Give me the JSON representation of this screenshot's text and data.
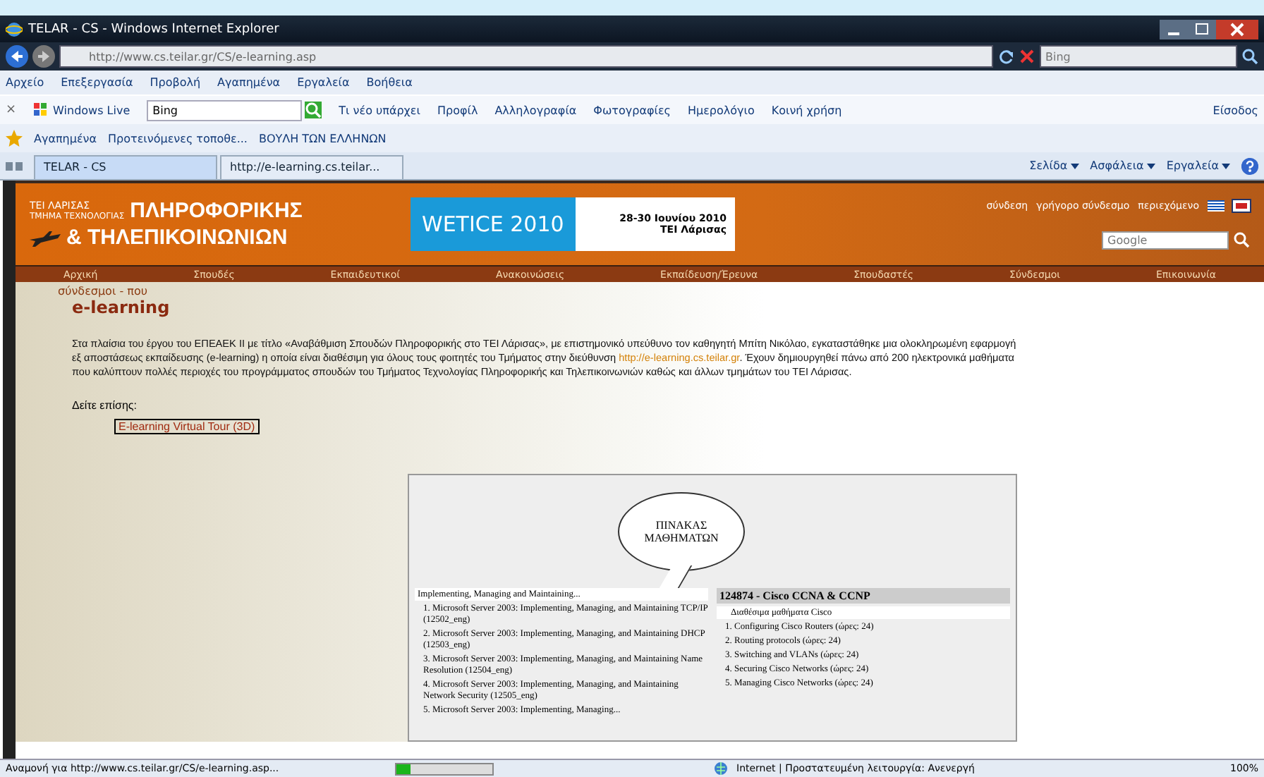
{
  "window": {
    "title": "TELAR - CS - Windows Internet Explorer"
  },
  "address_bar": {
    "value": "http://www.cs.teilar.gr/CS/e-learning.asp"
  },
  "search": {
    "placeholder": "Bing"
  },
  "menu": [
    "Αρχείο",
    "Επεξεργασία",
    "Προβολή",
    "Αγαπημένα",
    "Εργαλεία",
    "Βοήθεια"
  ],
  "links_bar": {
    "close": "×",
    "brand": "Windows Live",
    "search_value": "Bing",
    "links": [
      "Τι νέο υπάρχει",
      "Προφίλ",
      "Αλληλογραφία",
      "Φωτογραφίες",
      "Ημερολόγιο",
      "Κοινή χρήση"
    ],
    "signin": "Είσοδος"
  },
  "favorites_bar": {
    "label": "Αγαπημένα",
    "items": [
      "Προτεινόμενες τοποθε...",
      "ΒΟΥΛΗ ΤΩΝ ΕΛΛΗΝΩΝ"
    ]
  },
  "tabs": [
    {
      "label": "TELAR - CS",
      "selected": true
    },
    {
      "label": "http://e-learning.cs.teilar...",
      "selected": false
    }
  ],
  "commands": [
    "Σελίδα",
    "Ασφάλεια",
    "Εργαλεία"
  ],
  "site_header": {
    "org": "ΤΕΙ ΛΑΡΙΣΑΣ",
    "dept": "ΤΜΗΜΑ ΤΕΧΝΟΛΟΓΙΑΣ",
    "title_1": "ΠΛΗΡΟΦΟΡΙΚΗΣ",
    "title_2": "& ΤΗΛΕΠΙΚΟΙΝΩΝΙΩΝ",
    "banner": {
      "name": "WETICE 2010",
      "dates": "28-30 Ιουνίου 2010",
      "place": "ΤΕΙ Λάρισας"
    },
    "top_links": [
      "σύνδεση",
      "γρήγορο σύνδεσμο",
      "περιεχόμενο"
    ],
    "search_placeholder": "Google"
  },
  "nav": [
    "Αρχική",
    "Σπουδές",
    "Εκπαιδευτικοί",
    "Ανακοινώσεις",
    "Εκπαίδευση/Έρευνα",
    "Σπουδαστές",
    "Σύνδεσμοι",
    "Επικοινωνία"
  ],
  "breadcrumb": "σύνδεσμοι - που",
  "heading": "e-learning",
  "paragraph": "Στα πλαίσια του έργου του ΕΠΕΑΕΚ ΙΙ με τίτλο «Αναβάθμιση Σπουδών Πληροφορικής στο ΤΕΙ Λάρισας», με επιστημονικό υπεύθυνο τον καθηγητή Μπίτη Νικόλαο, εγκαταστάθηκε μια ολοκληρωμένη εφαρμογή εξ αποστάσεως εκπαίδευσης (e-learning) η οποία είναι διαθέσιμη για όλους τους φοιτητές του Τμήματος στην διεύθυνση ",
  "paragraph_link": "http://e-learning.cs.teilar.gr",
  "paragraph_end": ". Έχουν δημιουργηθεί πάνω από 200 ηλεκτρονικά μαθήματα που καλύπτουν πολλές περιοχές του προγράμματος σπουδών του Τμήματος Τεχνολογίας Πληροφορικής και Τηλεπικοινωνιών καθώς και άλλων τμημάτων του ΤΕΙ Λάρισας.",
  "see_also": "Δείτε επίσης:",
  "see_also_links": [
    "E-learning Virtual Tour (3D)"
  ],
  "screenshot": {
    "bubble": "ΠΙΝΑΚΑΣ ΜΑΘΗΜΑΤΩΝ",
    "left_heading": "Implementing, Managing and Maintaining...",
    "left_items": [
      "1. Microsoft Server 2003: Implementing, Managing, and Maintaining TCP/IP (12502_eng)",
      "2. Microsoft Server 2003: Implementing, Managing, and Maintaining DHCP (12503_eng)",
      "3. Microsoft Server 2003: Implementing, Managing, and Maintaining Name Resolution (12504_eng)",
      "4. Microsoft Server 2003: Implementing, Managing, and Maintaining Network Security (12505_eng)",
      "5. Microsoft Server 2003: Implementing, Managing..."
    ],
    "right_heading": "124874 - Cisco CCNA & CCNP",
    "right_sub": "Διαθέσιμα μαθήματα Cisco",
    "right_items": [
      "1. Configuring Cisco Routers (ώρες: 24)",
      "2. Routing protocols (ώρες: 24)",
      "3. Switching and VLANs (ώρες: 24)",
      "4. Securing Cisco Networks (ώρες: 24)",
      "5. Managing Cisco Networks (ώρες: 24)"
    ]
  },
  "status_bar": {
    "text": "Αναμονή για http://www.cs.teilar.gr/CS/e-learning.asp...",
    "progress": {
      "level": 0.15
    },
    "zone": "Internet | Προστατευμένη λειτουργία: Ανενεργή",
    "zoom": "100%"
  }
}
